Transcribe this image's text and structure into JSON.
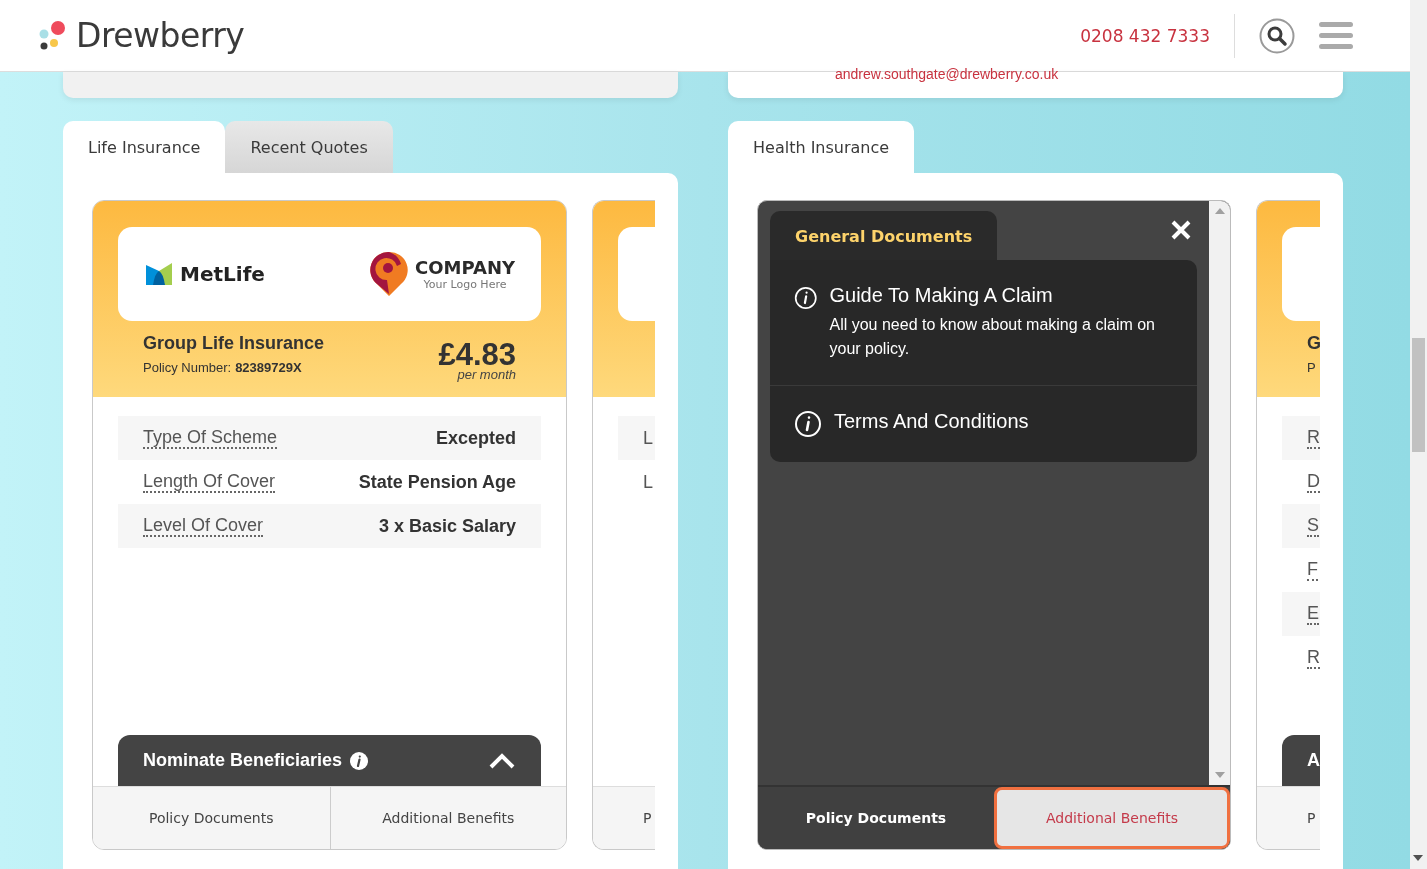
{
  "header": {
    "brand": "Drewberry",
    "phone": "0208 432 7333"
  },
  "top_cards": {
    "email": "andrew.southgate@drewberry.co.uk"
  },
  "left_panel": {
    "tabs": [
      {
        "label": "Life Insurance",
        "selected": true
      },
      {
        "label": "Recent Quotes",
        "selected": false
      }
    ],
    "card": {
      "insurer": "MetLife",
      "company_name": "COMPANY",
      "company_tagline": "Your Logo Here",
      "product": "Group Life Insurance",
      "policy_label": "Policy Number:",
      "policy_number": "82389729X",
      "price": "£4.83",
      "price_period": "per month",
      "rows": [
        {
          "label": "Type Of Scheme",
          "value": "Excepted"
        },
        {
          "label": "Length Of Cover",
          "value": "State Pension Age"
        },
        {
          "label": "Level Of Cover",
          "value": "3 x Basic Salary"
        }
      ],
      "expander": "Nominate Beneficiaries",
      "footer_buttons": [
        {
          "label": "Policy Documents",
          "focused": false
        },
        {
          "label": "Additional Benefits",
          "focused": false
        }
      ]
    },
    "partial_card": {
      "rows": [
        "L",
        "L"
      ],
      "footer": "P"
    }
  },
  "right_panel": {
    "tabs": [
      {
        "label": "Health Insurance",
        "selected": true
      }
    ],
    "documents": {
      "tab": "General Documents",
      "items": [
        {
          "title": "Guide To Making A Claim",
          "description": "All you need to know about making a claim on your policy."
        },
        {
          "title": "Terms And Conditions"
        }
      ],
      "footer_buttons": [
        {
          "label": "Policy Documents",
          "focused": false
        },
        {
          "label": "Additional Benefits",
          "focused": true
        }
      ]
    },
    "partial_card": {
      "title": "G",
      "policy": "P",
      "rows": [
        "R",
        "D",
        "S",
        "F",
        "E",
        "R"
      ],
      "expander": "A",
      "footer": "P"
    }
  }
}
